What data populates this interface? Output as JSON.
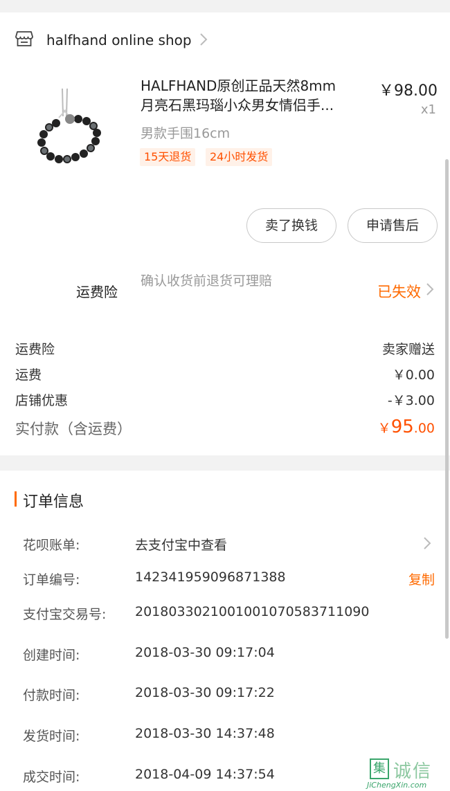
{
  "shop": {
    "name": "halfhand online shop"
  },
  "product": {
    "title_line1": "HALFHAND原创正品天然8mm",
    "title_line2": "月亮石黑玛瑙小众男女情侣手...",
    "price": "￥98.00",
    "quantity": "x1",
    "sku": "男款手围16cm",
    "tags": [
      "15天退货",
      "24小时发货"
    ]
  },
  "actions": {
    "sell": "卖了换钱",
    "after_sale": "申请售后"
  },
  "insurance": {
    "label": "运费险",
    "desc": "确认收货前退货可理赔",
    "status": "已失效"
  },
  "fees": [
    {
      "label": "运费险",
      "value": "卖家赠送"
    },
    {
      "label": "运费",
      "value": "￥0.00"
    },
    {
      "label": "店铺优惠",
      "value": "-￥3.00"
    }
  ],
  "total": {
    "label": "实付款（含运费）",
    "currency": "￥",
    "integer": "95",
    "decimal": ".00"
  },
  "order_info": {
    "title": "订单信息",
    "rows": [
      {
        "key": "花呗账单:",
        "value": "去支付宝中查看"
      },
      {
        "key": "订单编号:",
        "value": "142341959096871388",
        "action": "复制"
      },
      {
        "key": "支付宝交易号:",
        "value": "2018033021001001070583711090"
      },
      {
        "key": "创建时间:",
        "value": "2018-03-30 09:17:04"
      },
      {
        "key": "付款时间:",
        "value": "2018-03-30 09:17:22"
      },
      {
        "key": "发货时间:",
        "value": "2018-03-30 14:37:48"
      },
      {
        "key": "成交时间:",
        "value": "2018-04-09 14:37:54"
      }
    ]
  },
  "watermark": {
    "box_char": "集",
    "cn": "诚信",
    "en": "JiChengXin.com"
  },
  "colors": {
    "accent": "#ff6a00",
    "price_orange": "#ff5000",
    "tag_bg": "#fff1e8"
  }
}
